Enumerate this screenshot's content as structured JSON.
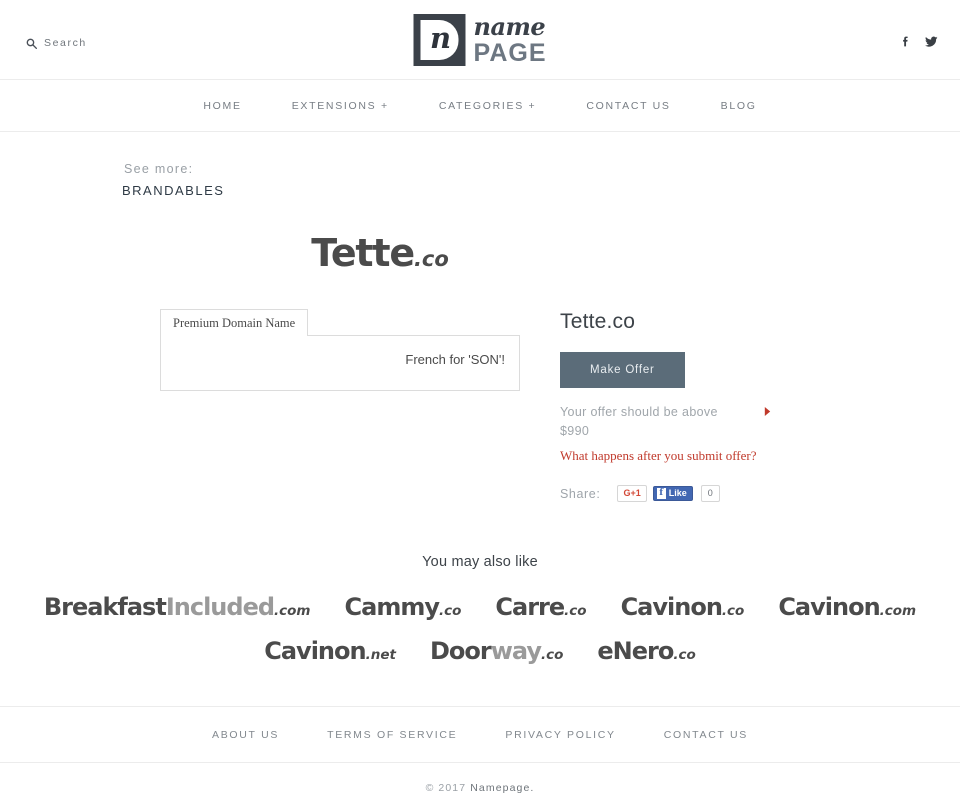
{
  "header": {
    "search": {
      "label": "Search",
      "icon": "search-icon"
    },
    "logo": {
      "mark_letter": "n",
      "name": "name",
      "page": "PAGE",
      "color": "#3b4149"
    },
    "socials": [
      {
        "name": "facebook-icon",
        "label": "f"
      },
      {
        "name": "twitter-icon",
        "label": "t"
      }
    ]
  },
  "nav": {
    "items": [
      {
        "label": "HOME",
        "key": "home"
      },
      {
        "label": "EXTENSIONS +",
        "key": "extensions"
      },
      {
        "label": "CATEGORIES +",
        "key": "categories"
      },
      {
        "label": "CONTACT US",
        "key": "contact-us"
      },
      {
        "label": "BLOG",
        "key": "blog"
      }
    ]
  },
  "breadcrumb": {
    "see_more_label": "See more:",
    "category": "BRANDABLES"
  },
  "domain_art": {
    "base": "Tette",
    "tld": ".co"
  },
  "detail": {
    "tab_label": "Premium Domain Name",
    "tab_content": "French for 'SON'!"
  },
  "offer": {
    "title": "Tette.co",
    "button_label": "Make Offer",
    "hint": "Your offer should be above",
    "amount": "$990",
    "info_link": "What happens after you submit offer?",
    "arrow_color": "#c0392b",
    "button_color": "#5b6c79"
  },
  "share": {
    "label": "Share:",
    "gplus_label": "G+1",
    "fb_f": "f",
    "fb_like_label": "Like",
    "fb_count": "0"
  },
  "also_like": {
    "title": "You may also like",
    "rows": [
      [
        {
          "a": "Breakfast",
          "b": "Included",
          "tld": ".com"
        },
        {
          "a": "Cammy",
          "b": "",
          "tld": ".co"
        },
        {
          "a": "Carre",
          "b": "",
          "tld": ".co"
        },
        {
          "a": "Cavinon",
          "b": "",
          "tld": ".co"
        },
        {
          "a": "Cavinon",
          "b": "",
          "tld": ".com"
        }
      ],
      [
        {
          "a": "Cavinon",
          "b": "",
          "tld": ".net"
        },
        {
          "a": "Door",
          "b": "way",
          "tld": ".co"
        },
        {
          "a": "eNero",
          "b": "",
          "tld": ".co"
        }
      ]
    ]
  },
  "footer": {
    "links": [
      {
        "label": "ABOUT US",
        "key": "about-us"
      },
      {
        "label": "TERMS OF SERVICE",
        "key": "terms-of-service"
      },
      {
        "label": "PRIVACY POLICY",
        "key": "privacy-policy"
      },
      {
        "label": "CONTACT US",
        "key": "contact-us"
      }
    ],
    "copyright_prefix": "© 2017 ",
    "copyright_brand": "Namepage."
  }
}
